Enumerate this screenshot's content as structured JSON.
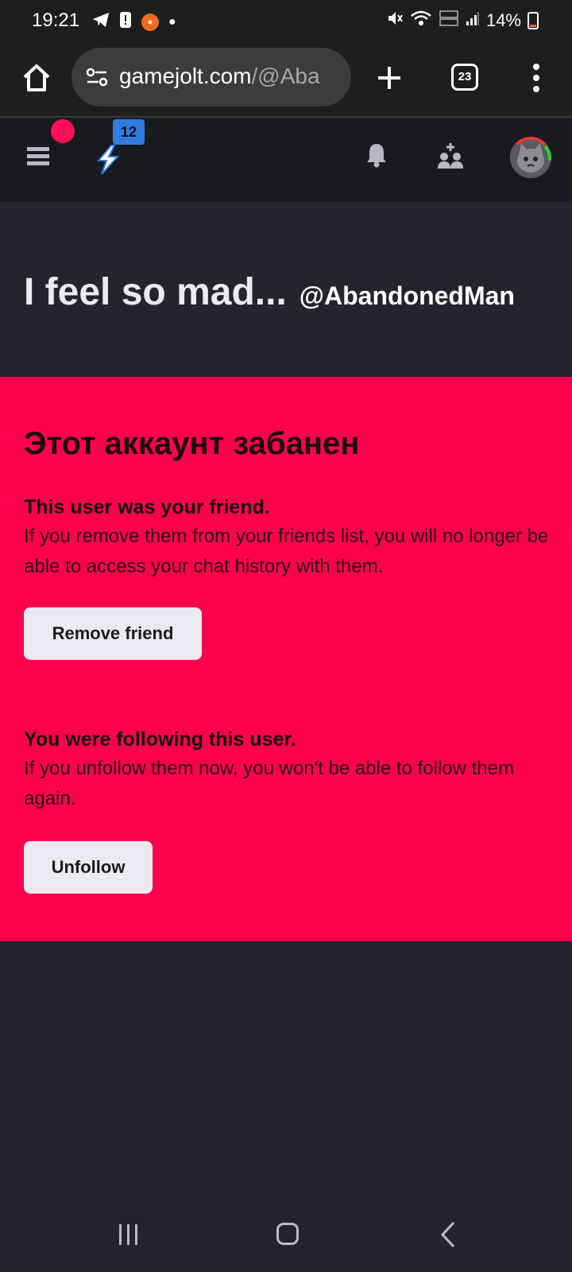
{
  "status_bar": {
    "time": "19:21",
    "left_icons": [
      "telegram-icon",
      "alert-icon",
      "recorder-icon",
      "dot-icon"
    ],
    "right_icons": [
      "mute-icon",
      "wifi-icon",
      "volte-icon",
      "signal-icon"
    ],
    "battery": "14%"
  },
  "browser": {
    "url_domain": "gamejolt.com",
    "url_rest": "/@Aba",
    "tabs_count": "23"
  },
  "site_nav": {
    "bolt_badge": "12",
    "accent_color": "#ff0f54",
    "badge_color": "#2f7de1"
  },
  "page": {
    "title": "I feel so mad...",
    "username": "@AbandonedMan"
  },
  "banned": {
    "heading": "Этот аккаунт забанен",
    "friend_lead": "This user was your friend.",
    "friend_desc": "If you remove them from your friends list, you will no longer be able to access your chat history with them.",
    "remove_button": "Remove friend",
    "follow_lead": "You were following this user.",
    "follow_desc": "If you unfollow them now, you won't be able to follow them again.",
    "unfollow_button": "Unfollow",
    "background_color": "#ff004c"
  }
}
